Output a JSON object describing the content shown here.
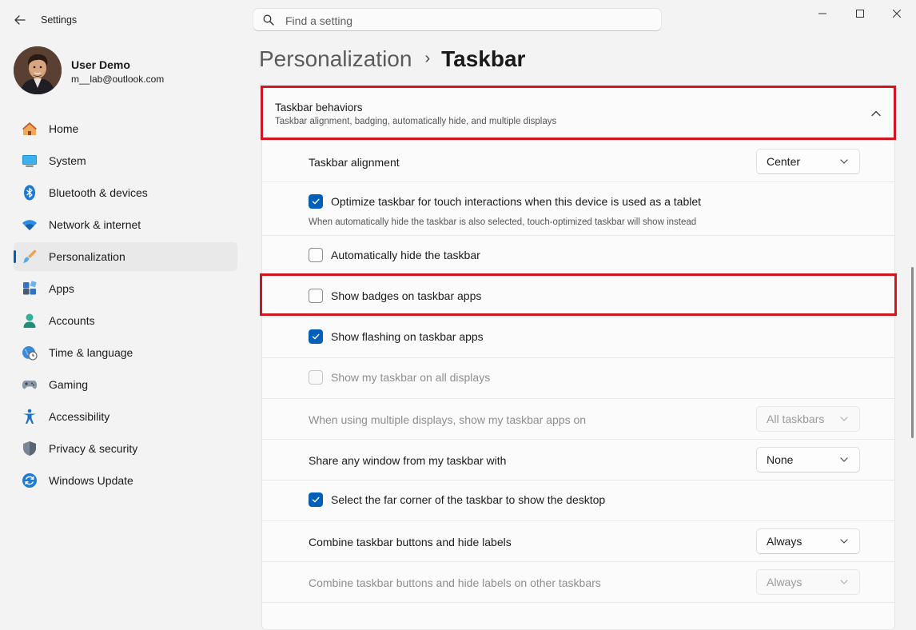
{
  "window": {
    "title": "Settings",
    "controls": [
      "minimize",
      "maximize",
      "close"
    ]
  },
  "search": {
    "placeholder": "Find a setting",
    "value": ""
  },
  "profile": {
    "name": "User Demo",
    "email": "m__lab@outlook.com"
  },
  "nav": {
    "items": [
      {
        "id": "home",
        "label": "Home",
        "icon": "home-icon"
      },
      {
        "id": "system",
        "label": "System",
        "icon": "monitor-icon"
      },
      {
        "id": "bluetooth",
        "label": "Bluetooth & devices",
        "icon": "bluetooth-icon"
      },
      {
        "id": "network",
        "label": "Network & internet",
        "icon": "wifi-icon"
      },
      {
        "id": "personalization",
        "label": "Personalization",
        "icon": "paintbrush-icon",
        "selected": true
      },
      {
        "id": "apps",
        "label": "Apps",
        "icon": "apps-icon"
      },
      {
        "id": "accounts",
        "label": "Accounts",
        "icon": "person-icon"
      },
      {
        "id": "time",
        "label": "Time & language",
        "icon": "globe-clock-icon"
      },
      {
        "id": "gaming",
        "label": "Gaming",
        "icon": "gamepad-icon"
      },
      {
        "id": "accessibility",
        "label": "Accessibility",
        "icon": "accessibility-icon"
      },
      {
        "id": "privacy",
        "label": "Privacy & security",
        "icon": "shield-icon"
      },
      {
        "id": "update",
        "label": "Windows Update",
        "icon": "update-icon"
      }
    ]
  },
  "breadcrumb": {
    "parent": "Personalization",
    "separator": "›",
    "current": "Taskbar"
  },
  "section": {
    "title": "Taskbar behaviors",
    "description": "Taskbar alignment, badging, automatically hide, and multiple displays",
    "expanded": true
  },
  "settings": {
    "alignment": {
      "label": "Taskbar alignment",
      "value": "Center"
    },
    "touch": {
      "label": "Optimize taskbar for touch interactions when this device is used as a tablet",
      "checked": true,
      "description": "When automatically hide the taskbar is also selected, touch-optimized taskbar will show instead"
    },
    "autohide": {
      "label": "Automatically hide the taskbar",
      "checked": false
    },
    "badges": {
      "label": "Show badges on taskbar apps",
      "checked": false
    },
    "flashing": {
      "label": "Show flashing on taskbar apps",
      "checked": true
    },
    "all_displays": {
      "label": "Show my taskbar on all displays",
      "checked": false,
      "disabled": true
    },
    "multi_display_apps": {
      "label": "When using multiple displays, show my taskbar apps on",
      "value": "All taskbars",
      "disabled": true
    },
    "share_window": {
      "label": "Share any window from my taskbar with",
      "value": "None"
    },
    "far_corner": {
      "label": "Select the far corner of the taskbar to show the desktop",
      "checked": true
    },
    "combine": {
      "label": "Combine taskbar buttons and hide labels",
      "value": "Always"
    },
    "combine_other": {
      "label": "Combine taskbar buttons and hide labels on other taskbars",
      "value": "Always",
      "disabled": true
    }
  },
  "colors": {
    "accent": "#005fb8",
    "highlight": "#d2161f",
    "background": "#f3f3f3",
    "card": "#fbfbfb"
  }
}
